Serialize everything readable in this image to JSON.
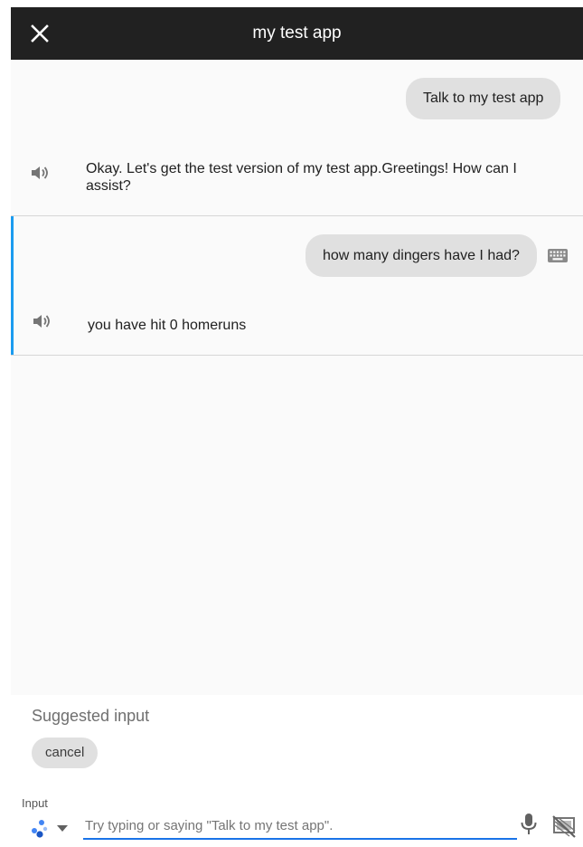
{
  "appbar": {
    "title": "my test app",
    "close_icon": "close-icon"
  },
  "conversation": [
    {
      "user_message": "Talk to my test app",
      "agent_response": "Okay. Let's get the test version of my test app.Greetings! How can I assist?"
    },
    {
      "user_message": "how many dingers have I had?",
      "input_mode_icon": "keyboard-icon",
      "agent_response": "you have hit 0 homeruns"
    }
  ],
  "suggestions": {
    "label": "Suggested input",
    "chips": [
      "cancel"
    ]
  },
  "input": {
    "label": "Input",
    "value": "",
    "placeholder": "Try typing or saying \"Talk to my test app\".",
    "assistant_icon": "assistant-dots-icon",
    "mic_icon": "mic-icon",
    "display_icon": "display-off-icon"
  },
  "colors": {
    "appbar": "#212121",
    "accent": "#1a9bf0",
    "bubble": "#e0e0e0",
    "chat_background": "#fafafa"
  }
}
